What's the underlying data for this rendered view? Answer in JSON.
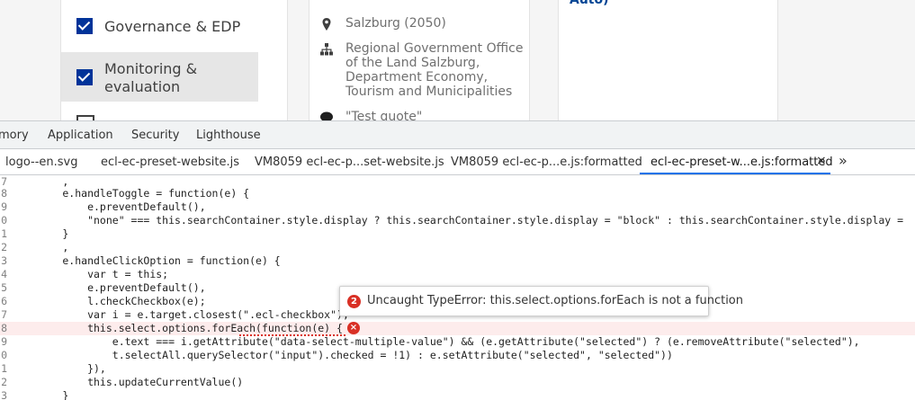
{
  "filters": {
    "items": [
      {
        "label": "Governance & EDP",
        "checked": true
      },
      {
        "label": "Monitoring & evaluation",
        "checked": true,
        "active": true
      },
      {
        "label": "",
        "checked": false
      }
    ]
  },
  "card": {
    "location": "Salzburg (2050)",
    "organisation": "Regional Government Office of the Land Salzburg, Department Economy, Tourism and Municipalities",
    "quote": "\"Test quote\"",
    "icons": {
      "location": "map-pin-icon",
      "organisation": "org-chart-icon",
      "quote": "speech-bubble-icon"
    }
  },
  "card2": {
    "partial_text": "Auto)"
  },
  "devtools": {
    "panel_tabs": [
      "mory",
      "Application",
      "Security",
      "Lighthouse"
    ],
    "file_tabs": [
      "logo--en.svg",
      "ecl-ec-preset-website.js",
      "VM8059 ecl-ec-p...set-website.js",
      "VM8059 ecl-ec-p...e.js:formatted",
      "ecl-ec-preset-w...e.js:formatted"
    ],
    "close_label": "×",
    "more_label": "»",
    "code_lines": [
      {
        "num": "7",
        "text": "        ,"
      },
      {
        "num": "8",
        "text": "        e.handleToggle = function(e) {"
      },
      {
        "num": "9",
        "text": "            e.preventDefault(),"
      },
      {
        "num": "0",
        "text": "            \"none\" === this.searchContainer.style.display ? this.searchContainer.style.display = \"block\" : this.searchContainer.style.display ="
      },
      {
        "num": "1",
        "text": "        }"
      },
      {
        "num": "2",
        "text": "        ,"
      },
      {
        "num": "3",
        "text": "        e.handleClickOption = function(e) {"
      },
      {
        "num": "4",
        "text": "            var t = this;"
      },
      {
        "num": "5",
        "text": "            e.preventDefault(),"
      },
      {
        "num": "6",
        "text": "            l.checkCheckbox(e);"
      },
      {
        "num": "7",
        "text": "            var i = e.target.closest(\".ecl-checkbox\");"
      },
      {
        "num": "8",
        "text": "            this.select.options.forEach(function(e) {",
        "error": true
      },
      {
        "num": "9",
        "text": "                e.text === i.getAttribute(\"data-select-multiple-value\") && (e.getAttribute(\"selected\") ? (e.removeAttribute(\"selected\"),"
      },
      {
        "num": "0",
        "text": "                t.selectAll.querySelector(\"input\").checked = !1) : e.setAttribute(\"selected\", \"selected\"))"
      },
      {
        "num": "1",
        "text": "            }),"
      },
      {
        "num": "2",
        "text": "            this.updateCurrentValue()"
      },
      {
        "num": "3",
        "text": "        }"
      }
    ],
    "error_tooltip": {
      "count": "2",
      "message": "Uncaught TypeError: this.select.options.forEach is not a function"
    },
    "inline_error_icon": "error-x-icon"
  },
  "colors": {
    "accent": "#1a73e8",
    "error": "#d93025",
    "checkbox": "#003399"
  }
}
